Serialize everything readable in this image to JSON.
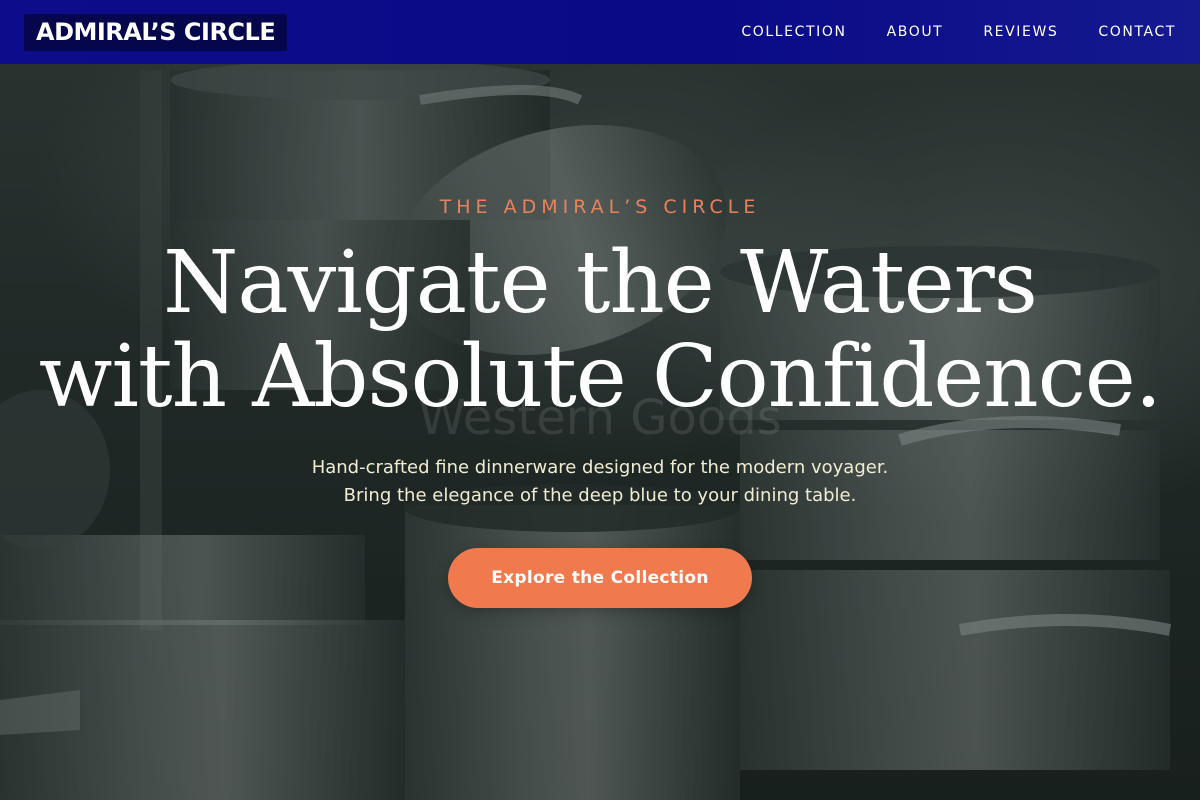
{
  "header": {
    "logo_text": "ADMIRAL’S CIRCLE",
    "nav": [
      {
        "label": "COLLECTION"
      },
      {
        "label": "ABOUT"
      },
      {
        "label": "REVIEWS"
      },
      {
        "label": "CONTACT"
      }
    ],
    "background_color": "#0a0a86"
  },
  "hero": {
    "kicker": "THE ADMIRAL’S CIRCLE",
    "headline_line1": "Navigate the Waters",
    "headline_line2": "with Absolute Confidence.",
    "ghost_text": "Western Goods",
    "subtext_line1": "Hand-crafted fine dinnerware designed for the modern voyager.",
    "subtext_line2": "Bring the elegance of the deep blue to your dining table.",
    "cta_label": "Explore the Collection",
    "accent_color": "#f07a4e"
  },
  "background": {
    "icon": "stacked-cooking-pots-photo"
  }
}
